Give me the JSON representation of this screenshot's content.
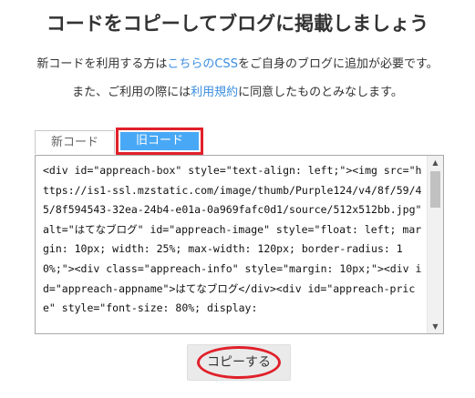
{
  "title": "コードをコピーしてブログに掲載しましょう",
  "note1": {
    "before": "新コードを利用する方は",
    "link": "こちらのCSS",
    "after": "をご自身のブログに追加が必要です。"
  },
  "note2": {
    "before": "また、ご利用の際には",
    "link": "利用規約",
    "after": "に同意したものとみなします。"
  },
  "tabs": {
    "new_label": "新コード",
    "old_label": "旧コード",
    "selected": "旧コード"
  },
  "code": "<div id=\"appreach-box\" style=\"text-align: left;\"><img src=\"https://is1-ssl.mzstatic.com/image/thumb/Purple124/v4/8f/59/45/8f594543-32ea-24b4-e01a-0a969fafc0d1/source/512x512bb.jpg\" alt=\"はてなブログ\" id=\"appreach-image\" style=\"float: left; margin: 10px; width: 25%; max-width: 120px; border-radius: 10%;\"><div class=\"appreach-info\" style=\"margin: 10px;\"><div id=\"appreach-appname\">はてなブログ</div><div id=\"appreach-price\" style=\"font-size: 80%; display:",
  "copy_button": "コピーする",
  "colors": {
    "accent_blue": "#49a8f5",
    "link_blue": "#3b8ee0",
    "highlight_red": "#e0202a"
  }
}
